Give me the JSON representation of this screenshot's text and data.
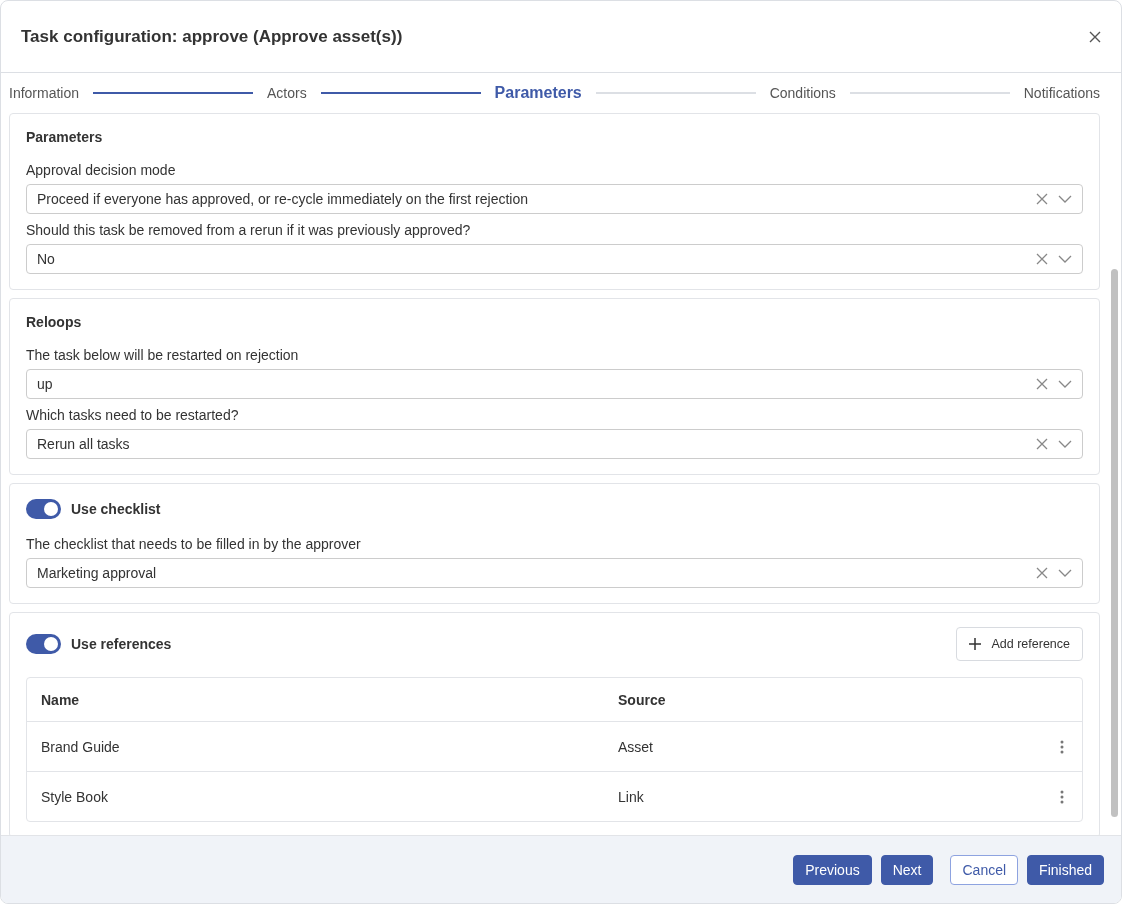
{
  "dialog": {
    "title": "Task configuration: approve (Approve asset(s))"
  },
  "steps": [
    {
      "label": "Information",
      "selected": false
    },
    {
      "label": "Actors",
      "selected": false
    },
    {
      "label": "Parameters",
      "selected": true
    },
    {
      "label": "Conditions",
      "selected": false
    },
    {
      "label": "Notifications",
      "selected": false
    }
  ],
  "sections": [
    {
      "kind": "fields",
      "heading": "Parameters",
      "fields": [
        {
          "label": "Approval decision mode",
          "value": "Proceed if everyone has approved, or re-cycle immediately on the first rejection"
        },
        {
          "label": "Should this task be removed from a rerun if it was previously approved?",
          "value": "No"
        }
      ]
    },
    {
      "kind": "fields",
      "heading": "Reloops",
      "fields": [
        {
          "label": "The task below will be restarted on rejection",
          "value": "up"
        },
        {
          "label": "Which tasks need to be restarted?",
          "value": "Rerun all tasks"
        }
      ]
    },
    {
      "kind": "toggle",
      "heading": "Use checklist",
      "on": true,
      "fields": [
        {
          "label": "The checklist that needs to be filled in by the approver",
          "value": "Marketing approval"
        }
      ]
    },
    {
      "kind": "table",
      "heading": "Use references",
      "on": true,
      "action": "Add reference",
      "columns": [
        "Name",
        "Source"
      ],
      "rows": [
        [
          "Brand Guide",
          "Asset"
        ],
        [
          "Style Book",
          "Link"
        ]
      ]
    }
  ],
  "buttons": [
    {
      "label": "Previous",
      "kind": "primary"
    },
    {
      "label": "Next",
      "kind": "primary"
    },
    {
      "label": "Cancel",
      "kind": "outline"
    },
    {
      "label": "Finished",
      "kind": "primary"
    }
  ]
}
